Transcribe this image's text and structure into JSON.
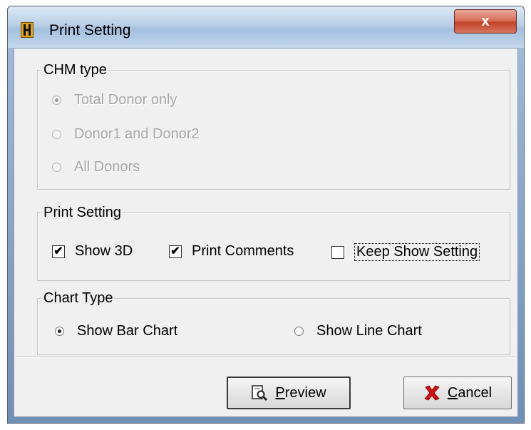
{
  "window": {
    "title": "Print Setting",
    "close_label": "x"
  },
  "chm_type": {
    "label": "CHM type",
    "options": [
      {
        "label": "Total Donor only",
        "checked": true,
        "enabled": false
      },
      {
        "label": "Donor1 and Donor2",
        "checked": false,
        "enabled": false
      },
      {
        "label": "All Donors",
        "checked": false,
        "enabled": false
      }
    ]
  },
  "print_setting": {
    "label": "Print Setting",
    "show_3d": {
      "label": "Show 3D",
      "checked": true
    },
    "print_comments": {
      "label": "Print Comments",
      "checked": true
    },
    "keep_show_setting": {
      "label": "Keep Show Setting",
      "checked": false
    }
  },
  "chart_type": {
    "label": "Chart Type",
    "bar": {
      "label": "Show Bar Chart",
      "checked": true
    },
    "line": {
      "label": "Show Line Chart",
      "checked": false
    }
  },
  "buttons": {
    "preview_mnemonic": "P",
    "preview_rest": "review",
    "cancel_mnemonic": "C",
    "cancel_rest": "ancel"
  },
  "icons": {
    "preview": "magnifier-document-icon",
    "cancel": "red-x-icon",
    "app": "app-icon"
  }
}
